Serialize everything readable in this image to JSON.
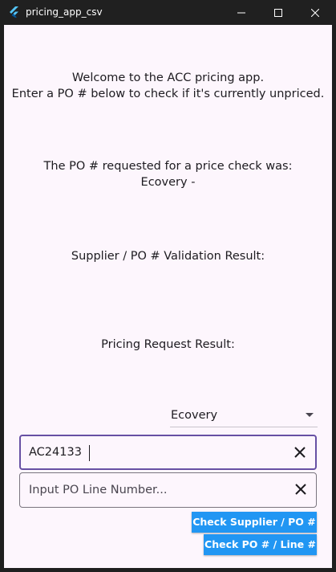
{
  "window": {
    "title": "pricing_app_csv",
    "icon": "flutter-logo-icon",
    "controls": [
      "minimize-icon",
      "maximize-icon",
      "close-icon"
    ]
  },
  "main": {
    "welcome_line1": "Welcome to the ACC pricing app.",
    "welcome_line2": "Enter a PO # below to check if it's currently unpriced.",
    "requested_label": "The PO # requested for a price check was:",
    "requested_value": "Ecovery -",
    "validation_label": "Supplier / PO # Validation Result:",
    "pricing_label": "Pricing Request Result:"
  },
  "supplier_dropdown": {
    "selected": "Ecovery"
  },
  "po_input": {
    "value": "AC24133"
  },
  "line_input": {
    "placeholder": "Input PO Line Number..."
  },
  "buttons": {
    "check_supplier_po": "Check Supplier / PO #",
    "check_po_line": "Check PO # / Line #"
  },
  "colors": {
    "background": "#fdf6fd",
    "titlebar": "#202020",
    "focused_border": "#6750a4",
    "button": "#2196f3"
  }
}
